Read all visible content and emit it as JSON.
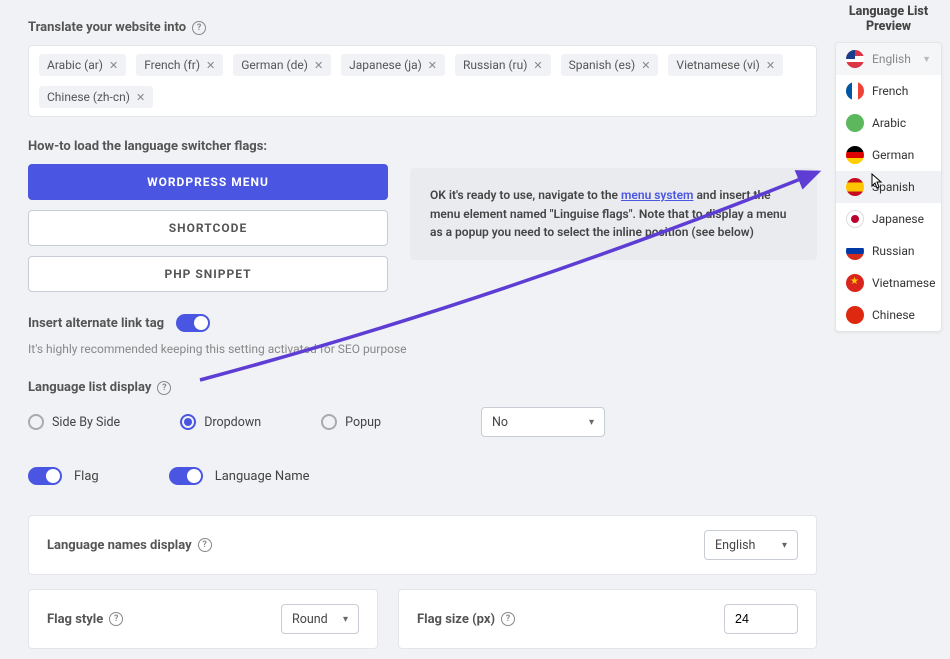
{
  "translate": {
    "title": "Translate your website into",
    "chips": [
      "Arabic (ar)",
      "French (fr)",
      "German (de)",
      "Japanese (ja)",
      "Russian (ru)",
      "Spanish (es)",
      "Vietnamese (vi)",
      "Chinese (zh-cn)"
    ]
  },
  "load_flags": {
    "title": "How-to load the language switcher flags:",
    "buttons": {
      "primary": "WORDPRESS MENU",
      "shortcode": "SHORTCODE",
      "snippet": "PHP SNIPPET"
    },
    "info_pre": "OK it's ready to use, navigate to the ",
    "info_link": "menu system",
    "info_post": " and insert the menu element named \"Linguise flags\". Note that to display a menu as a popup you need to select the inline position (see below)"
  },
  "alt_link": {
    "label": "Insert alternate link tag",
    "hint": "It's highly recommended keeping this setting activated for SEO purpose"
  },
  "list_display": {
    "title": "Language list display",
    "options": {
      "side": "Side By Side",
      "dropdown": "Dropdown",
      "popup": "Popup"
    },
    "selected": "dropdown",
    "select_value": "No"
  },
  "toggles": {
    "flag": "Flag",
    "lang_name": "Language Name"
  },
  "names_display": {
    "label": "Language names display",
    "value": "English"
  },
  "flag_style": {
    "label": "Flag style",
    "value": "Round"
  },
  "flag_size": {
    "label": "Flag size (px)",
    "value": "24"
  },
  "preview": {
    "title": "Language List Preview",
    "header": "English",
    "items": [
      {
        "name": "French",
        "flag": "fr"
      },
      {
        "name": "Arabic",
        "flag": "ar"
      },
      {
        "name": "German",
        "flag": "de"
      },
      {
        "name": "Spanish",
        "flag": "es",
        "hover": true
      },
      {
        "name": "Japanese",
        "flag": "ja"
      },
      {
        "name": "Russian",
        "flag": "ru"
      },
      {
        "name": "Vietnamese",
        "flag": "vn"
      },
      {
        "name": "Chinese",
        "flag": "cn"
      }
    ]
  }
}
